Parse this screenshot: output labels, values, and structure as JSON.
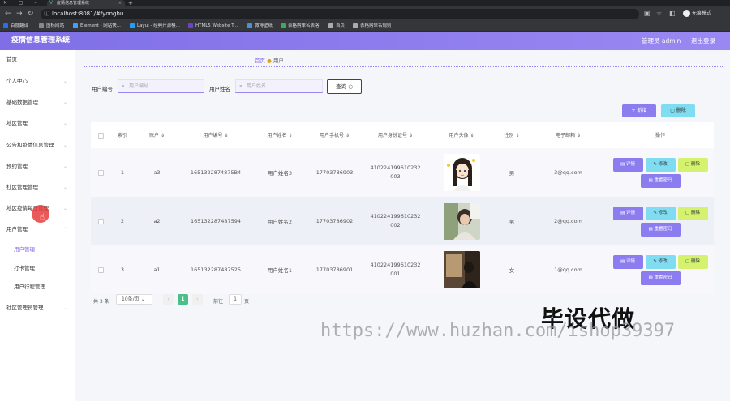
{
  "browser": {
    "tab_title": "疫情信息管理系统",
    "url": "localhost:8081/#/yonghu",
    "profile_label": "无痕模式",
    "bookmarks": [
      {
        "label": "百度翻译",
        "color": "#2b6de8"
      },
      {
        "label": "图标网站",
        "color": "#888888"
      },
      {
        "label": "Element - 网站快...",
        "color": "#409eff"
      },
      {
        "label": "Layui - 经典开源模...",
        "color": "#1e9fff"
      },
      {
        "label": "HTML5 Website T...",
        "color": "#6f42c1"
      },
      {
        "label": "微博壁纸",
        "color": "#4a90d9"
      },
      {
        "label": "表格购单名表格",
        "color": "#3aaa5a"
      },
      {
        "label": "首页",
        "color": "#aaaaaa"
      },
      {
        "label": "表格购单名规则",
        "color": "#aaaaaa"
      }
    ]
  },
  "header": {
    "title": "疫情信息管理系统",
    "user": "管理员 admin",
    "logout": "退出登录"
  },
  "sidebar": {
    "items": [
      {
        "label": "首页",
        "chevron": false
      },
      {
        "label": "个人中心",
        "chevron": true
      },
      {
        "label": "基础数据管理",
        "chevron": true
      },
      {
        "label": "地区管理",
        "chevron": true
      },
      {
        "label": "公告和疫情信息管理",
        "chevron": true
      },
      {
        "label": "预约管理",
        "chevron": true
      },
      {
        "label": "社区管理管理",
        "chevron": true
      },
      {
        "label": "地区疫情每日管理",
        "chevron": true
      },
      {
        "label": "用户管理",
        "chevron": true
      }
    ],
    "sub_items": [
      "用户管理",
      "打卡管理",
      "用户行程管理"
    ],
    "last_item": "社区管理员管理"
  },
  "breadcrumb": {
    "home": "首页",
    "current": "用户"
  },
  "search": {
    "label1": "用户编号",
    "placeholder1": "用户编号",
    "label2": "用户姓名",
    "placeholder2": "用户姓名",
    "query_label": "查询"
  },
  "actions": {
    "add": "+ 新增",
    "delete": "删除"
  },
  "table": {
    "headers": [
      "索引",
      "账户",
      "用户编号",
      "用户姓名",
      "用户手机号",
      "用户身份证号",
      "用户头像",
      "性别",
      "电子邮箱",
      "操作"
    ],
    "rows": [
      {
        "index": "1",
        "account": "a3",
        "code": "1651322874875B4",
        "name": "用户姓名3",
        "phone": "17703786903",
        "idcard": "410224199610232003",
        "gender": "男",
        "email": "3@qq.com",
        "avatar": "cartoon-girl"
      },
      {
        "index": "2",
        "account": "a2",
        "code": "165132287487594",
        "name": "用户姓名2",
        "phone": "17703786902",
        "idcard": "410224199610232002",
        "gender": "男",
        "email": "2@qq.com",
        "avatar": "photo-person"
      },
      {
        "index": "3",
        "account": "a1",
        "code": "165132287487525",
        "name": "用户姓名1",
        "phone": "17703786901",
        "idcard": "410224199610232001",
        "gender": "女",
        "email": "1@qq.com",
        "avatar": "photo-room"
      }
    ],
    "op_labels": {
      "detail": "详情",
      "edit": "修改",
      "remove": "删除",
      "reset": "重置密码"
    }
  },
  "pager": {
    "total": "共 3 条",
    "page_size": "10条/页",
    "current_page": "1",
    "goto_label": "前往",
    "goto_value": "1",
    "page_suffix": "页"
  },
  "watermark": {
    "big": "毕设代做",
    "url": "https://www.huzhan.com/ishop39397"
  },
  "colors": {
    "header": "#8b7cf0",
    "accent": "#8a6be8",
    "edit": "#80dcf0",
    "remove": "#d4f26d",
    "pager_active": "#4bbf8a"
  }
}
